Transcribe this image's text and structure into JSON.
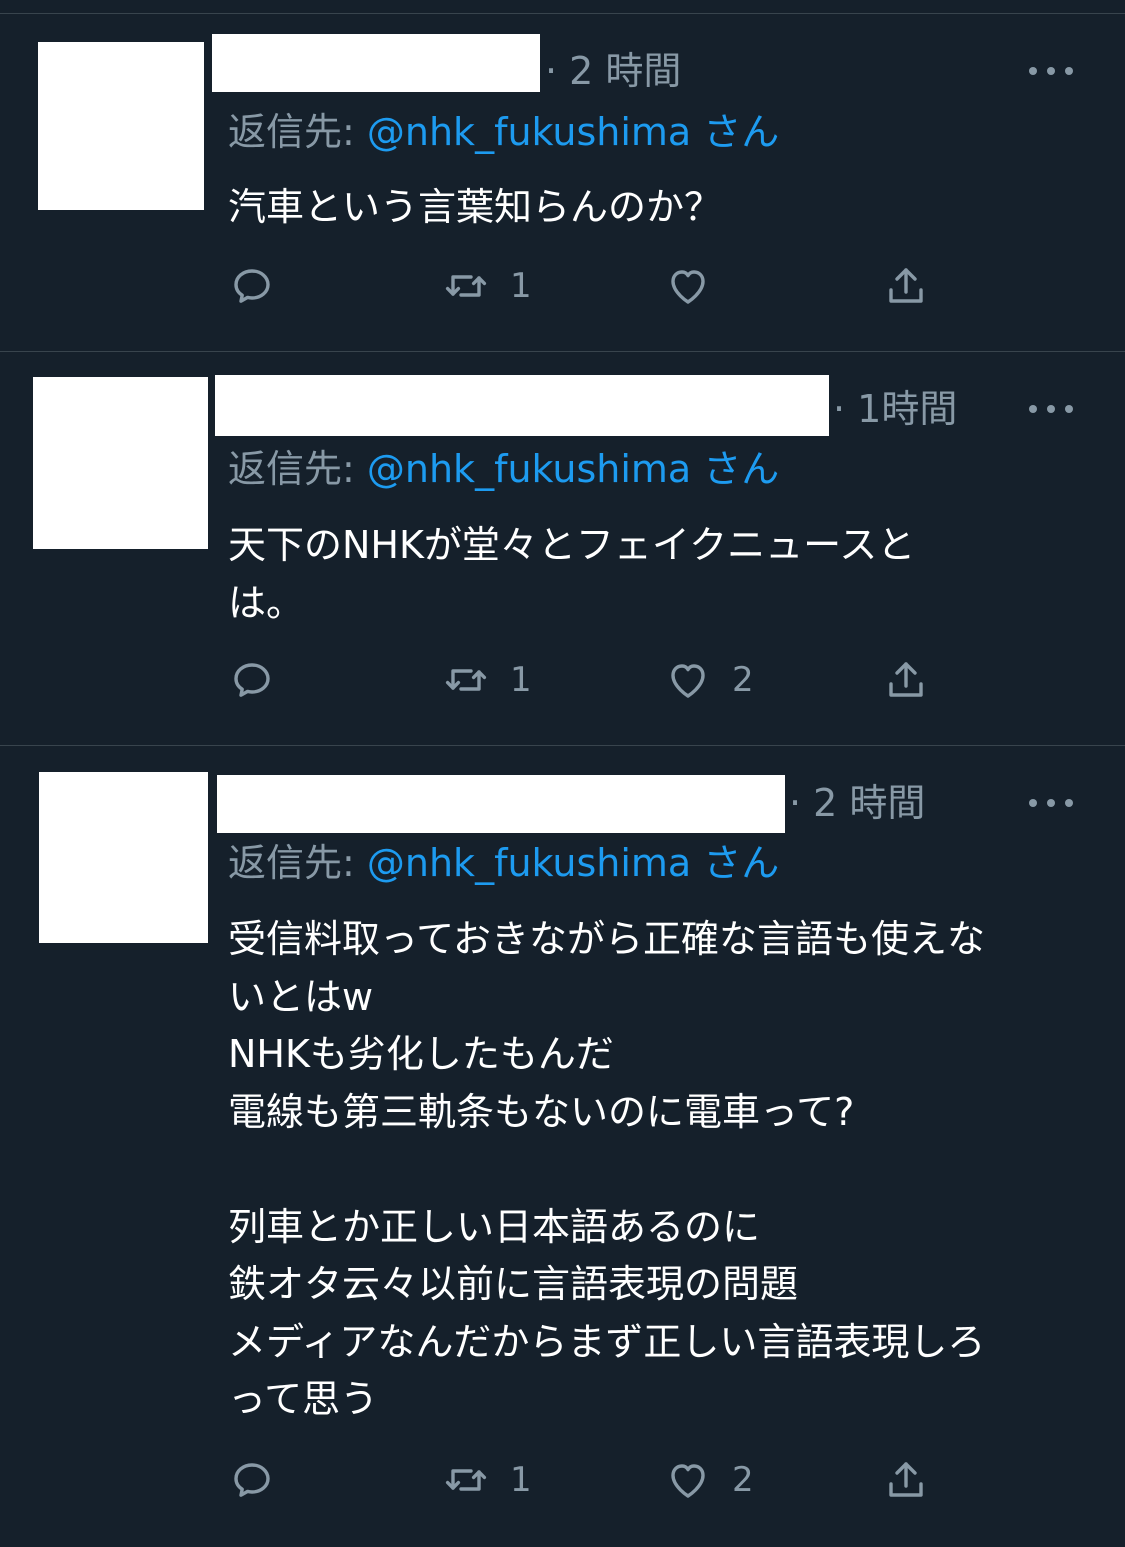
{
  "colors": {
    "background": "#15202b",
    "divider": "#38444d",
    "secondary_text": "#8899a6",
    "link": "#1d9bf0",
    "primary_text": "#ffffff"
  },
  "tweets": [
    {
      "time": "· 2 時間",
      "reply_prefix": "返信先: ",
      "reply_handle": "@nhk_fukushima",
      "reply_suffix": " さん",
      "text": "汽車という言葉知らんのか？",
      "retweets": "1",
      "likes": ""
    },
    {
      "time": "· 1時間",
      "reply_prefix": "返信先: ",
      "reply_handle": "@nhk_fukushima",
      "reply_suffix": " さん",
      "text": "天下のNHKが堂々とフェイクニュースと\nは。",
      "retweets": "1",
      "likes": "2"
    },
    {
      "time": "· 2 時間",
      "reply_prefix": "返信先: ",
      "reply_handle": "@nhk_fukushima",
      "reply_suffix": " さん",
      "text": "受信料取っておきながら正確な言語も使えな\nいとはw\nNHKも劣化したもんだ\n電線も第三軌条もないのに電車って?\n\n列車とか正しい日本語あるのに\n鉄オタ云々以前に言語表現の問題\nメディアなんだからまず正しい言語表現しろ\nって思う",
      "retweets": "1",
      "likes": "2"
    }
  ],
  "icons": {
    "reply": "reply-icon",
    "retweet": "retweet-icon",
    "like": "heart-icon",
    "share": "share-icon",
    "more": "more-icon"
  }
}
